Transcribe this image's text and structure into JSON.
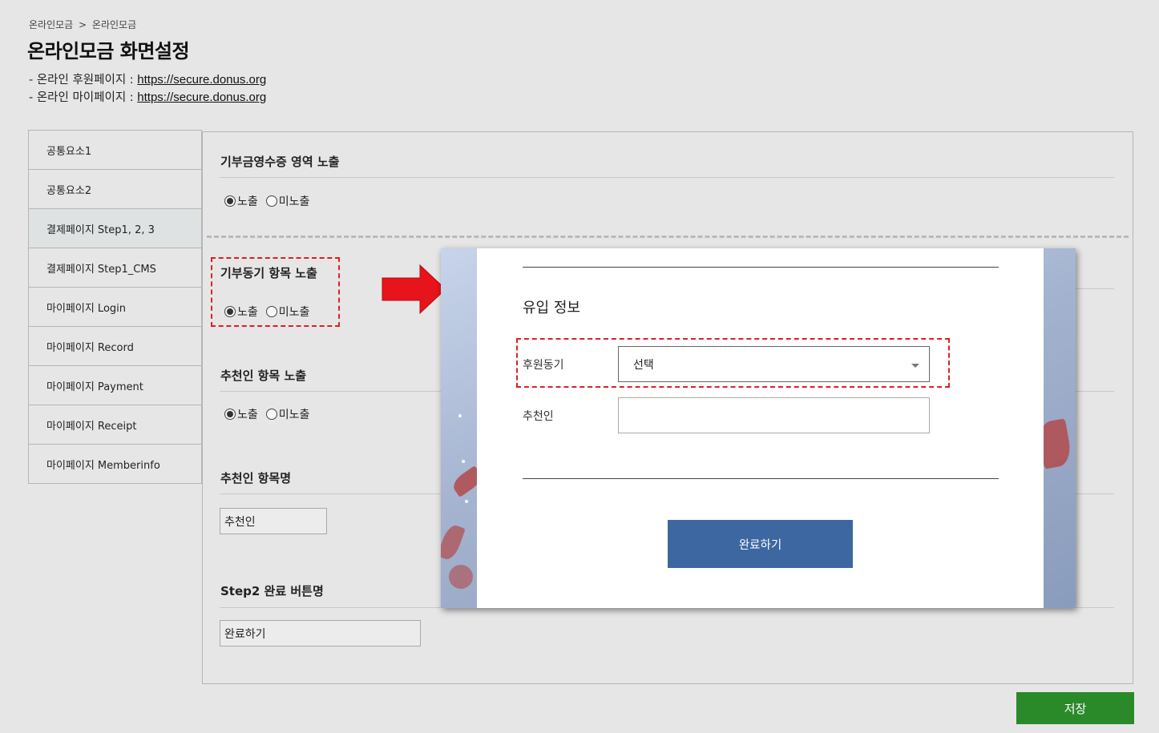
{
  "breadcrumb": {
    "parent": "온라인모금",
    "separator": ">",
    "current": "온라인모금"
  },
  "page_title": "온라인모금 화면설정",
  "links": [
    {
      "prefix": "- 온라인 후원페이지 : ",
      "url": "https://secure.donus.org"
    },
    {
      "prefix": "- 온라인 마이페이지 : ",
      "url": "https://secure.donus.org"
    }
  ],
  "sidebar": {
    "items": [
      {
        "label": "공통요소1"
      },
      {
        "label": "공통요소2"
      },
      {
        "label": "결제페이지 Step1, 2, 3",
        "active": true
      },
      {
        "label": "결제페이지 Step1_CMS"
      },
      {
        "label": "마이페이지 Login"
      },
      {
        "label": "마이페이지 Record"
      },
      {
        "label": "마이페이지 Payment"
      },
      {
        "label": "마이페이지 Receipt"
      },
      {
        "label": "마이페이지 Memberinfo"
      }
    ]
  },
  "settings": {
    "receipt_area": {
      "title": "기부금영수증 영역 노출",
      "option_show": "노출",
      "option_hide": "미노출",
      "selected": "노출"
    },
    "motive_item": {
      "title": "기부동기 항목 노출",
      "option_show": "노출",
      "option_hide": "미노출",
      "selected": "노출"
    },
    "recommender_item": {
      "title": "추천인 항목 노출",
      "option_show": "노출",
      "option_hide": "미노출",
      "selected": "노출"
    },
    "recommender_name": {
      "title": "추천인 항목명",
      "value": "추천인"
    },
    "step2_button_name": {
      "title": "Step2 완료 버튼명",
      "value": "완료하기"
    }
  },
  "preview": {
    "section_title": "유입 정보",
    "motive_label": "후원동기",
    "motive_select_value": "선택",
    "recommender_label": "추천인",
    "recommender_value": "",
    "complete_button": "완료하기"
  },
  "save_button": "저장",
  "colors": {
    "save_green": "#2a8a2a",
    "preview_button_blue": "#3d67a0",
    "highlight_red": "#e02020",
    "arrow_red": "#e8141b"
  }
}
